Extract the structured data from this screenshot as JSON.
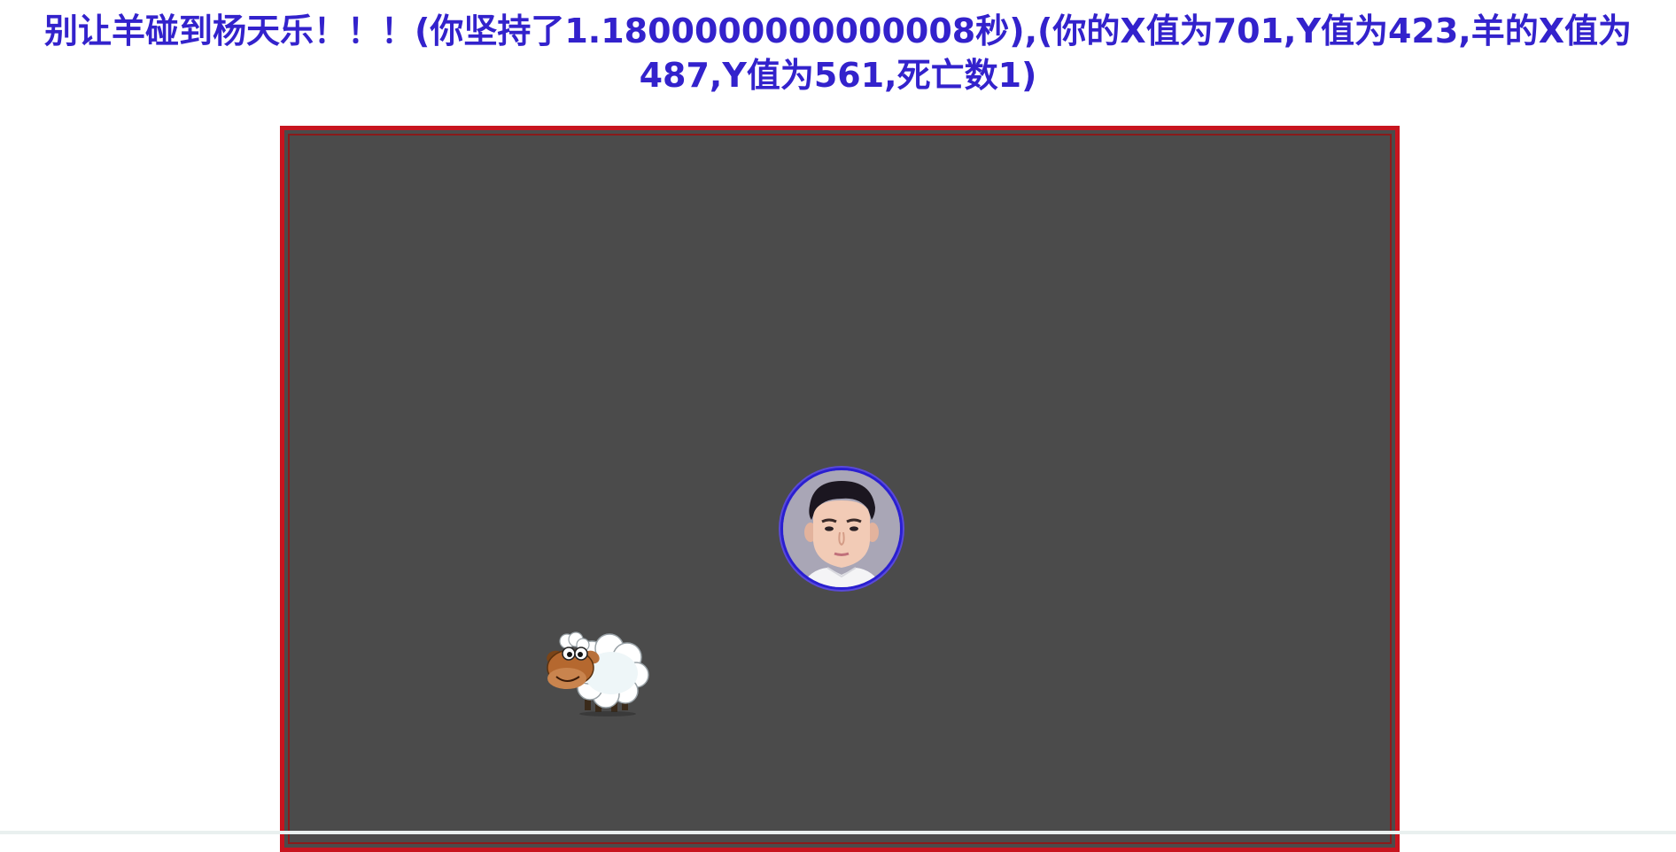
{
  "status": {
    "line1": "别让羊碰到杨天乐！！！(你坚持了1.1800000000000008秒),(你的X值为701,Y值为423,羊的X值为",
    "line2": "487,Y值为561,死亡数1)"
  },
  "game": {
    "player_icon": "boy-face-icon",
    "enemy_icon": "sheep-icon"
  },
  "colors": {
    "title": "#3322cc",
    "arena_border": "#c8141e",
    "arena_bg": "#4b4b4b",
    "player_ring": "#2a1fd0"
  }
}
